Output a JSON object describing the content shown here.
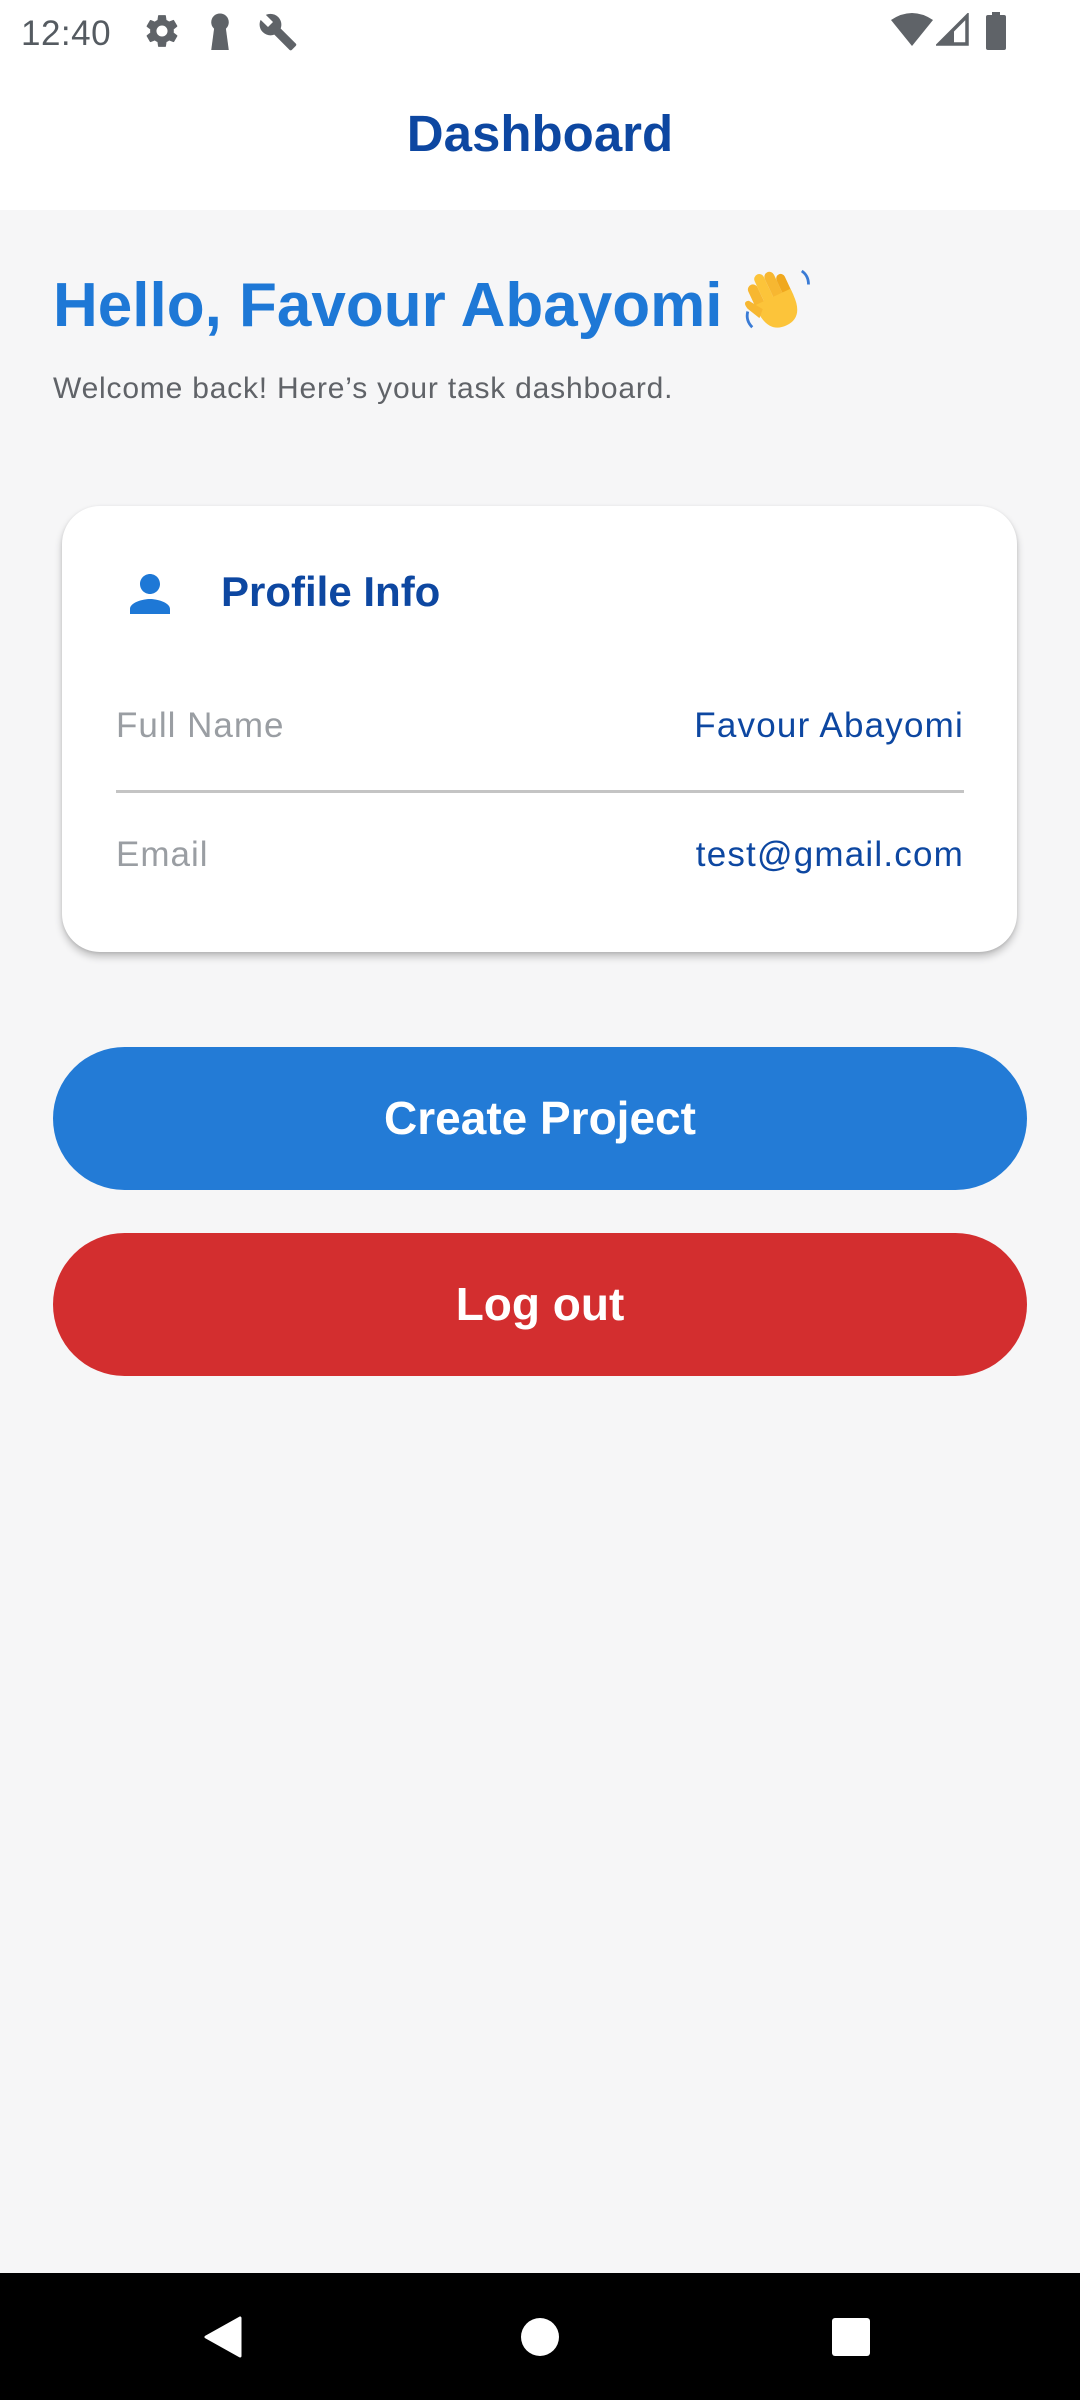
{
  "status_bar": {
    "time": "12:40",
    "left_icons": [
      "settings-icon",
      "keyhole-icon",
      "wrench-icon"
    ],
    "right_icons": [
      "wifi-icon",
      "cellular-signal-icon",
      "battery-icon"
    ]
  },
  "app_bar": {
    "title": "Dashboard"
  },
  "greeting": {
    "text": "Hello, Favour Abayomi",
    "emoji_icon": "waving-hand-icon",
    "subtitle": "Welcome back! Here’s your task dashboard."
  },
  "profile_card": {
    "icon": "person-icon",
    "title": "Profile Info",
    "rows": [
      {
        "label": "Full Name",
        "value": "Favour Abayomi"
      },
      {
        "label": "Email",
        "value": "test@gmail.com"
      }
    ]
  },
  "buttons": {
    "create_project": "Create Project",
    "log_out": "Log out"
  },
  "nav_bar": {
    "icons": [
      "back-icon",
      "home-icon",
      "recents-icon"
    ]
  },
  "colors": {
    "primary_dark": "#0d47a1",
    "primary": "#237bd6",
    "danger": "#d32e2f",
    "background": "#f6f6f7"
  }
}
